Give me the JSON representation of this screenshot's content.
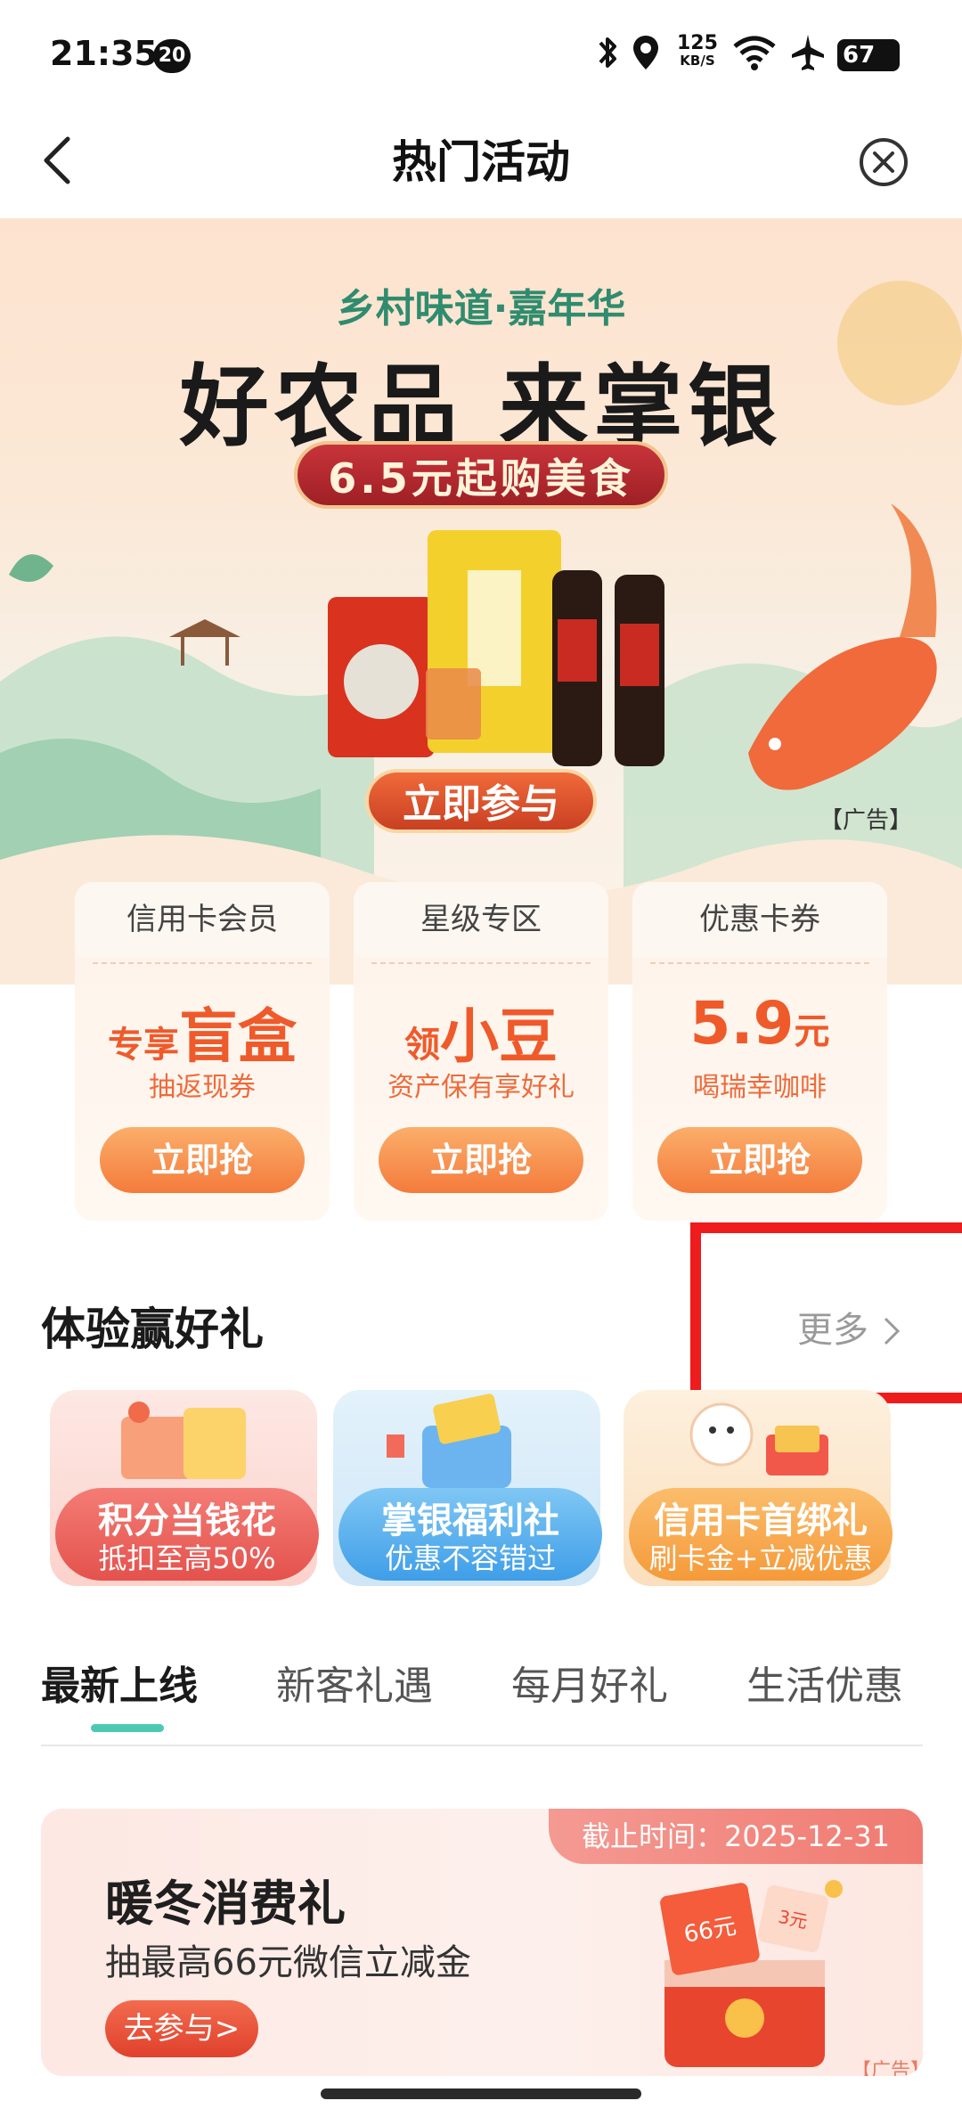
{
  "status_bar": {
    "time": "21:35",
    "notification_count": "20",
    "net_speed_value": "125",
    "net_speed_unit": "KB/S",
    "battery": "67"
  },
  "nav": {
    "title": "热门活动"
  },
  "banner": {
    "subtitle": "乡村味道·嘉年华",
    "title": "好农品 来掌银",
    "pill": "6.5元起购美食",
    "cta": "立即参与",
    "ad_tag": "【广告】"
  },
  "cards": [
    {
      "tab": "信用卡会员",
      "prefix": "专享",
      "highlight": "盲盒",
      "suffix": "",
      "desc": "抽返现券",
      "button": "立即抢"
    },
    {
      "tab": "星级专区",
      "prefix": "领",
      "highlight": "小豆",
      "suffix": "",
      "desc": "资产保有享好礼",
      "button": "立即抢"
    },
    {
      "tab": "优惠卡券",
      "prefix": "",
      "highlight": "5.9",
      "suffix": "元",
      "desc": "喝瑞幸咖啡",
      "button": "立即抢"
    }
  ],
  "section": {
    "title": "体验赢好礼",
    "more": "更多"
  },
  "tiles": [
    {
      "title": "积分当钱花",
      "subtitle": "抵扣至高50%"
    },
    {
      "title": "掌银福利社",
      "subtitle": "优惠不容错过"
    },
    {
      "title": "信用卡首绑礼",
      "subtitle": "刷卡金+立减优惠"
    }
  ],
  "tabs": [
    "最新上线",
    "新客礼遇",
    "每月好礼",
    "生活优惠"
  ],
  "activity": {
    "deadline": "截止时间：2025-12-31",
    "title": "暖冬消费礼",
    "description": "抽最高66元微信立减金",
    "button": "去参与>",
    "ad_tag": "【广告】",
    "red_packet_1": "66元",
    "red_packet_2": "3元"
  },
  "colors": {
    "accent_orange": "#ef5a2b",
    "highlight_red": "#ee1c1c",
    "tab_indicator": "#4cc9b3"
  }
}
